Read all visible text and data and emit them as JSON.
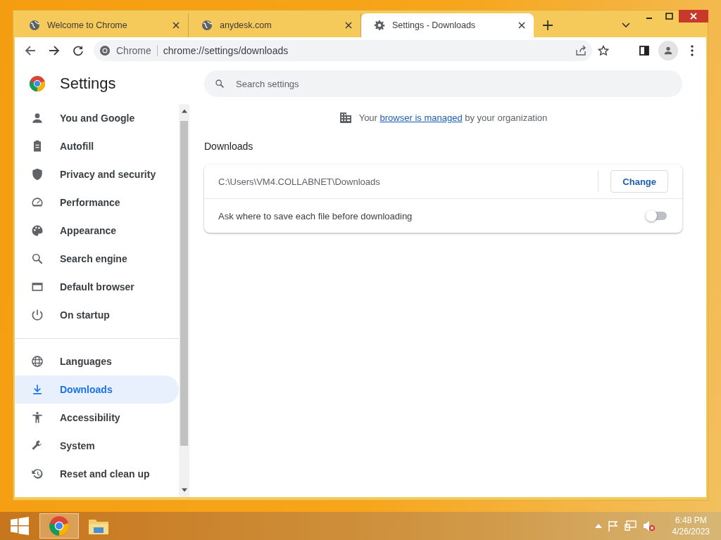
{
  "tabs": [
    {
      "title": "Welcome to Chrome",
      "selected": false
    },
    {
      "title": "anydesk.com",
      "selected": false
    },
    {
      "title": "Settings - Downloads",
      "selected": true
    }
  ],
  "address_bar": {
    "site_label": "Chrome",
    "url": "chrome://settings/downloads"
  },
  "sidebar": {
    "title": "Settings",
    "groups": [
      [
        {
          "label": "You and Google",
          "selected": false
        },
        {
          "label": "Autofill",
          "selected": false
        },
        {
          "label": "Privacy and security",
          "selected": false
        },
        {
          "label": "Performance",
          "selected": false
        },
        {
          "label": "Appearance",
          "selected": false
        },
        {
          "label": "Search engine",
          "selected": false
        },
        {
          "label": "Default browser",
          "selected": false
        },
        {
          "label": "On startup",
          "selected": false
        }
      ],
      [
        {
          "label": "Languages",
          "selected": false
        },
        {
          "label": "Downloads",
          "selected": true
        },
        {
          "label": "Accessibility",
          "selected": false
        },
        {
          "label": "System",
          "selected": false
        },
        {
          "label": "Reset and clean up",
          "selected": false
        }
      ]
    ]
  },
  "search": {
    "placeholder": "Search settings"
  },
  "managed_notice": {
    "before": "Your",
    "link": "browser is managed",
    "after": "by your organization"
  },
  "section": {
    "title": "Downloads",
    "location": "C:\\Users\\VM4.COLLABNET\\Downloads",
    "change_button": "Change",
    "ask_label": "Ask where to save each file before downloading",
    "ask_on": false
  },
  "taskbar": {
    "time": "6:48 PM",
    "date": "4/26/2023"
  }
}
